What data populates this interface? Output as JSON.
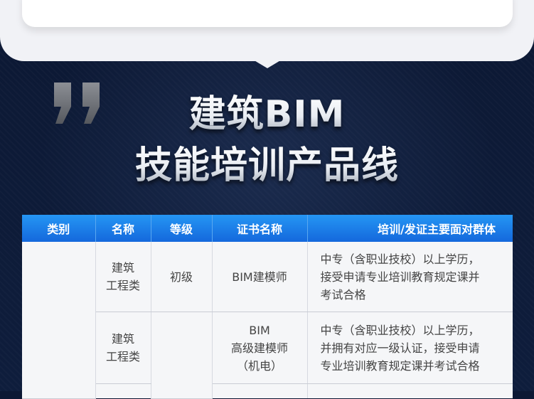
{
  "title": {
    "line1": "建筑BIM",
    "line2": "技能培训产品线"
  },
  "table": {
    "headers": [
      "类别",
      "名称",
      "等级",
      "证书名称",
      "培训/发证主要面对群体"
    ],
    "rows": [
      {
        "name": "建筑\n工程类",
        "level": "初级",
        "cert": "BIM建模师",
        "audience": "中专（含职业技校）以上学历，\n接受申请专业培训教育规定课并\n考试合格"
      },
      {
        "name": "建筑\n工程类",
        "level": "",
        "cert": "BIM\n高级建模师\n（机电）",
        "audience": "中专（含职业技校）以上学历，\n并拥有对应一级认证，接受申请\n专业培训教育规定课并考试合格"
      }
    ]
  },
  "colors": {
    "background": "#0d1a36",
    "header_blue": "#1d7fe8",
    "panel": "#f1f2f6"
  },
  "icons": [
    "quote-mark-icon"
  ]
}
